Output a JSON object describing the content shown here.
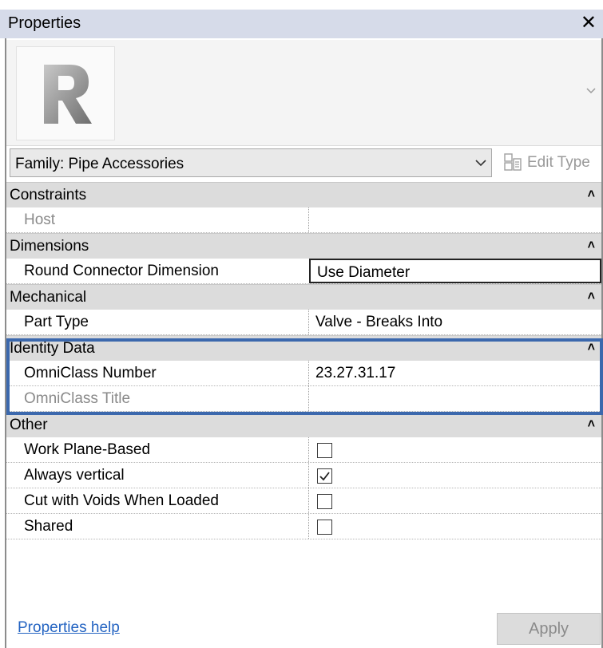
{
  "window": {
    "title": "Properties",
    "close_glyph": "✕"
  },
  "type_selector": {
    "family_label": "Family: Pipe Accessories",
    "edit_type_label": "Edit Type",
    "logo_icon": "revit-r-logo-icon"
  },
  "groups": [
    {
      "name": "Constraints",
      "rows": [
        {
          "key": "Host",
          "value": "",
          "kind": "text",
          "dim": true
        }
      ]
    },
    {
      "name": "Dimensions",
      "rows": [
        {
          "key": "Round Connector Dimension",
          "value": "Use Diameter",
          "kind": "text",
          "editing": true
        }
      ]
    },
    {
      "name": "Mechanical",
      "rows": [
        {
          "key": "Part Type",
          "value": "Valve - Breaks Into",
          "kind": "text"
        }
      ]
    },
    {
      "name": "Identity Data",
      "rows": [
        {
          "key": "OmniClass Number",
          "value": "23.27.31.17",
          "kind": "text"
        },
        {
          "key": "OmniClass Title",
          "value": "",
          "kind": "text",
          "dim": true
        }
      ]
    },
    {
      "name": "Other",
      "rows": [
        {
          "key": "Work Plane-Based",
          "checked": false,
          "kind": "checkbox"
        },
        {
          "key": "Always vertical",
          "checked": true,
          "kind": "checkbox"
        },
        {
          "key": "Cut with Voids When Loaded",
          "checked": false,
          "kind": "checkbox"
        },
        {
          "key": "Shared",
          "checked": false,
          "kind": "checkbox"
        }
      ]
    }
  ],
  "footer": {
    "help_link": "Properties help",
    "apply_label": "Apply"
  },
  "colors": {
    "titlebar": "#d6dbe9",
    "group_header": "#dcdcdc",
    "highlight_border": "#3b68ad",
    "link": "#2464c2"
  }
}
